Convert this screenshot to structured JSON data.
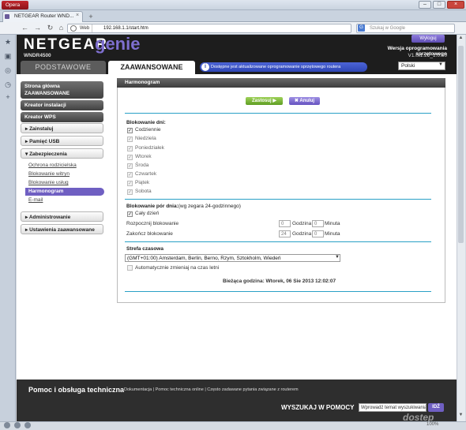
{
  "browser": {
    "opera_label": "Opera",
    "tab_title": "NETGEAR Router WND...",
    "tab_close": "×",
    "new_tab": "+",
    "nav_back": "←",
    "nav_forward": "→",
    "nav_reload": "↻",
    "nav_home": "⌂",
    "address_web": "Web",
    "address_url": "192.168.1.1/start.htm",
    "search_engine": "G",
    "search_placeholder": "Szukaj w Google",
    "window_min": "–",
    "window_max": "□",
    "window_close": "×",
    "side_icons": [
      "★",
      "▣",
      "◎",
      "◷",
      "+"
    ],
    "scroll_up": "▲",
    "scroll_down": "▼"
  },
  "header": {
    "logo": "NETGEAR",
    "logo_suffix": "genie",
    "model": "WNDR4500",
    "logout_label": "Wyloguj",
    "firmware_label": "Wersja oprogramowania sprzętowego",
    "firmware_version": "V1.0.1.20_1.0.40",
    "language": "Polski",
    "tab_basic": "PODSTAWOWE",
    "tab_advanced": "ZAAWANSOWANE",
    "update_notice": "Dostępne jest aktualizowane oprogramowanie sprzętowego routera"
  },
  "left_nav": {
    "home": "Strona główna ZAAWANSOWANE",
    "setup_wizard": "Kreator instalacji",
    "wps_wizard": "Kreator WPS",
    "setup": "Zainstaluj",
    "usb": "Pamięć USB",
    "security": "Zabezpieczenia",
    "security_items": [
      "Ochrona rodzicielska",
      "Blokowanie witryn",
      "Blokowanie usług",
      "Harmonogram",
      "E-mail"
    ],
    "administration": "Administrowanie",
    "advanced_setup": "Ustawienia zaawansowane"
  },
  "panel": {
    "title": "Harmonogram",
    "apply_label": "Zastosuj ▶",
    "cancel_label": "✖ Anuluj",
    "days_title": "Blokowanie dni:",
    "days": [
      "Codziennie",
      "Niedziela",
      "Poniedziałek",
      "Wtorek",
      "Środa",
      "Czwartek",
      "Piątek",
      "Sobota"
    ],
    "time_title": "Blokowanie pór dnia:",
    "time_note": "(wg zegara 24-godzinnego)",
    "all_day": "Cały dzień",
    "start_label": "Rozpocznij blokowanie",
    "start_hour": "0",
    "start_minute": "0",
    "end_label": "Zakończ blokowanie",
    "end_hour": "24",
    "end_minute": "0",
    "hour_unit": "Godzina",
    "minute_unit": "Minuta",
    "tz_title": "Strefa czasowa",
    "timezone": "(GMT+01:00) Amsterdam, Berlin, Berno, Rzym, Sztokholm, Wiedeń",
    "dst_label": "Automatycznie zmieniaj na czas letni",
    "current_time_label": "Bieżąca godzina:",
    "current_time": "Wtorek, 06 Sie 2013 12:02:07",
    "check": "✓"
  },
  "footer": {
    "title": "Pomoc i obsługa techniczna",
    "links": "Dokumentacja | Pomoc techniczna online | Często zadawane pytania związane z routerem",
    "search_label": "WYSZUKAJ W POMOCY",
    "search_value": "Wprowadź temat wyszukiwania",
    "go_label": "IDŹ"
  },
  "watermark": "dostep",
  "status": {
    "zoom": "100%"
  }
}
